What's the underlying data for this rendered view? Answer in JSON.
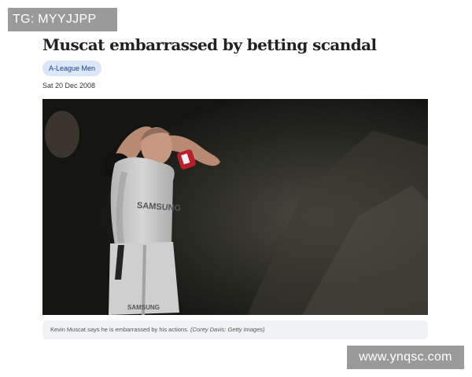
{
  "watermarks": {
    "top": "TG: MYYJJPP",
    "bottom": "www.ynqsc.com"
  },
  "article": {
    "headline": "Muscat embarrassed by betting scandal",
    "tag": "A-League Men",
    "date": "Sat 20 Dec 2008",
    "caption": {
      "text": "Kevin Muscat says he is embarrassed by his actions.",
      "credit": "(Corey Davis: Getty Images)"
    },
    "photo": {
      "shirt_text": "SAMSUNG",
      "shorts_text": "SAMSUNG",
      "colors": {
        "background": "#1d1d19",
        "kit": "#c9c9c9",
        "armband": "#b81f2a"
      }
    }
  }
}
